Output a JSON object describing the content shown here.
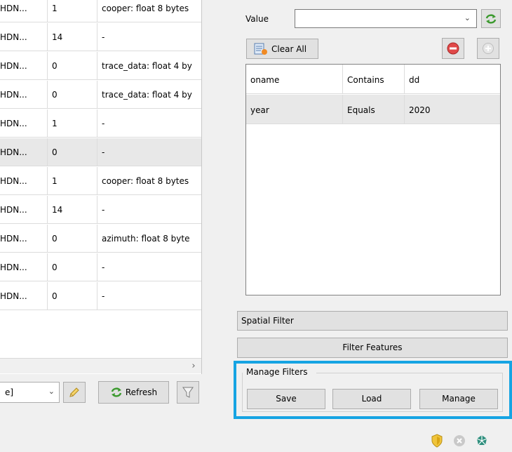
{
  "left_table": {
    "rows": [
      {
        "col1": "HDN...",
        "col2": "1",
        "col3": "cooper: float 8 bytes"
      },
      {
        "col1": "HDN...",
        "col2": "14",
        "col3": "-"
      },
      {
        "col1": "HDN...",
        "col2": "0",
        "col3": "trace_data: float 4 by"
      },
      {
        "col1": "HDN...",
        "col2": "0",
        "col3": "trace_data: float 4 by"
      },
      {
        "col1": "HDN...",
        "col2": "1",
        "col3": "-"
      },
      {
        "col1": "HDN...",
        "col2": "0",
        "col3": "-"
      },
      {
        "col1": "HDN...",
        "col2": "1",
        "col3": "cooper: float 8 bytes"
      },
      {
        "col1": "HDN...",
        "col2": "14",
        "col3": "-"
      },
      {
        "col1": "HDN...",
        "col2": "0",
        "col3": "azimuth: float 8 byte"
      },
      {
        "col1": "HDN...",
        "col2": "0",
        "col3": "-"
      },
      {
        "col1": "HDN...",
        "col2": "0",
        "col3": "-"
      }
    ],
    "selected_row": 5
  },
  "left_toolbar": {
    "combo_value": "e]",
    "refresh_label": "Refresh"
  },
  "filter_panel": {
    "value_label": "Value",
    "value_combo": "",
    "clear_all_label": "Clear All",
    "rows": [
      {
        "field": "oname",
        "op": "Contains",
        "value": "dd"
      },
      {
        "field": "year",
        "op": "Equals",
        "value": "2020"
      }
    ],
    "spatial_filter_label": "Spatial Filter",
    "filter_features_label": "Filter Features"
  },
  "manage_filters": {
    "title": "Manage Filters",
    "save_label": "Save",
    "load_label": "Load",
    "manage_label": "Manage"
  },
  "colors": {
    "highlight_border": "#16a4e3",
    "refresh_green": "#3c9a2f",
    "minus_red": "#e04848"
  }
}
